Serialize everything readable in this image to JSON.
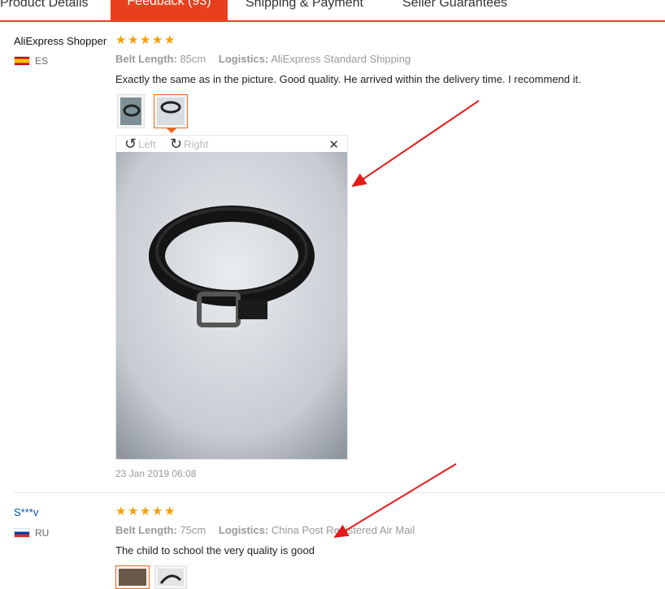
{
  "tabs": [
    {
      "label": "Product Details"
    },
    {
      "label": "Feedback (93)"
    },
    {
      "label": "Shipping & Payment"
    },
    {
      "label": "Seller Guarantees"
    }
  ],
  "reviews": [
    {
      "reviewer": "AliExpress Shopper",
      "country": "ES",
      "rating": 5,
      "attr1_label": "Belt Length:",
      "attr1_value": "85cm",
      "attr2_label": "Logistics:",
      "attr2_value": "AliExpress Standard Shipping",
      "text": "Exactly the same as in the picture. Good quality. He arrived within the delivery time. I recommend it.",
      "date": "23 Jan 2019 06:08",
      "photos": 2
    },
    {
      "reviewer": "S***v",
      "country": "RU",
      "rating": 5,
      "attr1_label": "Belt Length:",
      "attr1_value": "75cm",
      "attr2_label": "Logistics:",
      "attr2_value": "China Post Registered Air Mail",
      "text": "The child to school the very quality is good",
      "photos": 2
    }
  ],
  "viewer": {
    "rotate_left_label": "Left",
    "rotate_right_label": "Right",
    "close_glyph": "✕"
  },
  "star_glyph": "★",
  "colors": {
    "accent": "#e8401c",
    "star": "#f5a000",
    "annotation_arrow": "#e31b1b"
  }
}
